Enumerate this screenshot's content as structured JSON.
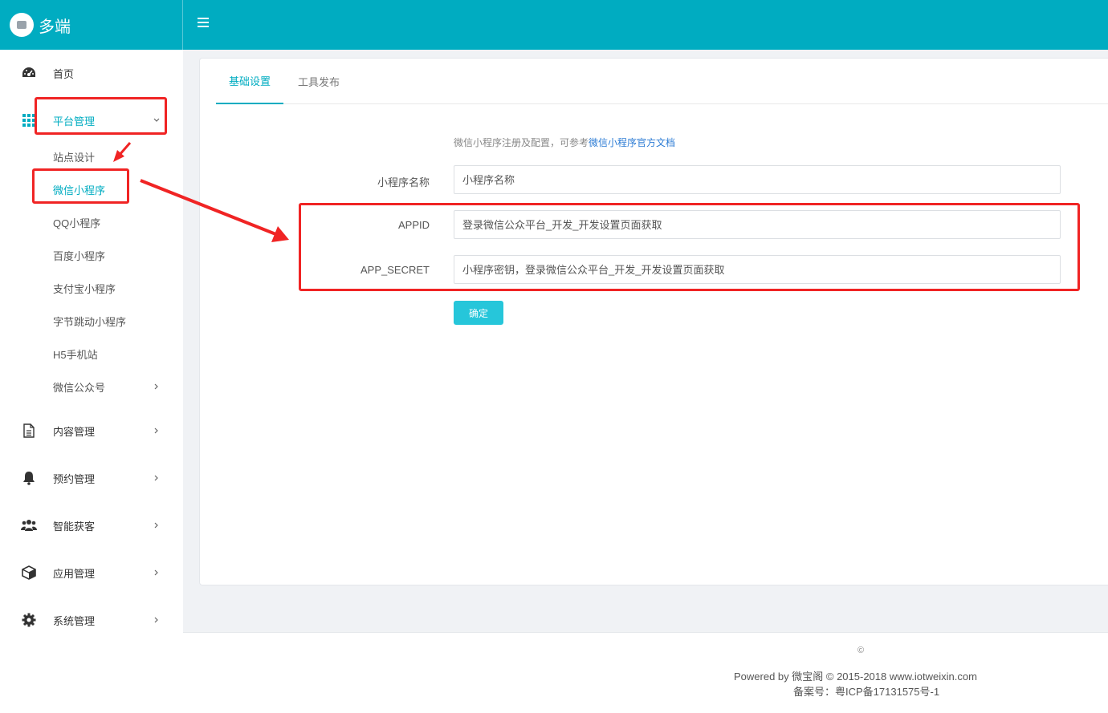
{
  "header": {
    "brand": "多端"
  },
  "sidebar": {
    "items": [
      {
        "label": "首页",
        "icon": "dashboard-icon"
      },
      {
        "label": "平台管理",
        "icon": "grid-icon"
      },
      {
        "label": "内容管理",
        "icon": "document-icon"
      },
      {
        "label": "预约管理",
        "icon": "bell-icon"
      },
      {
        "label": "智能获客",
        "icon": "users-icon"
      },
      {
        "label": "应用管理",
        "icon": "cube-icon"
      },
      {
        "label": "系统管理",
        "icon": "gear-icon"
      }
    ],
    "platform_subitems": [
      {
        "label": "站点设计"
      },
      {
        "label": "微信小程序"
      },
      {
        "label": "QQ小程序"
      },
      {
        "label": "百度小程序"
      },
      {
        "label": "支付宝小程序"
      },
      {
        "label": "字节跳动小程序"
      },
      {
        "label": "H5手机站"
      },
      {
        "label": "微信公众号"
      }
    ]
  },
  "main": {
    "tabs": [
      {
        "label": "基础设置"
      },
      {
        "label": "工具发布"
      }
    ],
    "hint_text": "微信小程序注册及配置，可参考",
    "hint_link": "微信小程序官方文档",
    "fields": [
      {
        "label": "小程序名称",
        "placeholder": "小程序名称"
      },
      {
        "label": "APPID",
        "placeholder": "登录微信公众平台_开发_开发设置页面获取"
      },
      {
        "label": "APP_SECRET",
        "placeholder": "小程序密钥，登录微信公众平台_开发_开发设置页面获取"
      }
    ],
    "submit_label": "确定"
  },
  "footer": {
    "copyright_symbol": "©",
    "powered": "Powered by 微宝阁 © 2015-2018 www.iotweixin.com",
    "record": "备案号：粤ICP备17131575号-1"
  },
  "colors": {
    "primary": "#00acc1",
    "button": "#26c6da",
    "link": "#2b7bd4",
    "annotation": "#f02424"
  }
}
